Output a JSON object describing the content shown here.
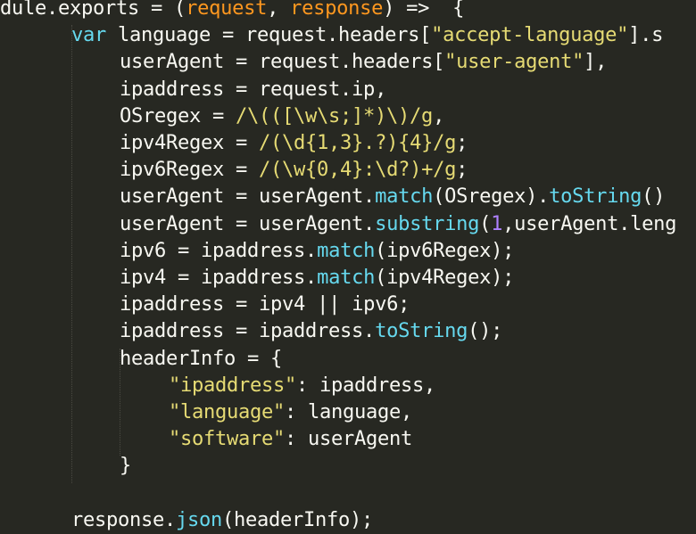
{
  "theme": {
    "background": "#272822",
    "text": "#f8f8f2",
    "keyword": "#66d9ef",
    "string": "#e6db74",
    "method": "#66d9ef",
    "param": "#fd971f",
    "number": "#ae81ff",
    "operator": "#f92672"
  },
  "lines": [
    {
      "indent": 0,
      "tokens": [
        [
          "text",
          "dule.exports "
        ],
        [
          "text",
          "= "
        ],
        [
          "text",
          "("
        ],
        [
          "param",
          "request"
        ],
        [
          "text",
          ", "
        ],
        [
          "param",
          "response"
        ],
        [
          "text",
          ") "
        ],
        [
          "text",
          "=>  "
        ],
        [
          "text",
          "{"
        ]
      ]
    },
    {
      "indent": 1,
      "tokens": [
        [
          "keyword",
          "var "
        ],
        [
          "text",
          "language "
        ],
        [
          "text",
          "= "
        ],
        [
          "text",
          "request.headers["
        ],
        [
          "string",
          "\"accept-language\""
        ],
        [
          "text",
          "].s"
        ]
      ]
    },
    {
      "indent": 2,
      "tokens": [
        [
          "text",
          "userAgent "
        ],
        [
          "text",
          "= "
        ],
        [
          "text",
          "request.headers["
        ],
        [
          "string",
          "\"user-agent\""
        ],
        [
          "text",
          "],"
        ]
      ]
    },
    {
      "indent": 2,
      "tokens": [
        [
          "text",
          "ipaddress "
        ],
        [
          "text",
          "= "
        ],
        [
          "text",
          "request.ip,"
        ]
      ]
    },
    {
      "indent": 2,
      "tokens": [
        [
          "text",
          "OSregex "
        ],
        [
          "text",
          "= "
        ],
        [
          "string",
          "/\\(([\\w\\s;]*)\\)/g"
        ],
        [
          "text",
          ","
        ]
      ]
    },
    {
      "indent": 2,
      "tokens": [
        [
          "text",
          "ipv4Regex "
        ],
        [
          "text",
          "= "
        ],
        [
          "string",
          "/(\\d{1,3}.?){4}/g"
        ],
        [
          "text",
          ";"
        ]
      ]
    },
    {
      "indent": 2,
      "tokens": [
        [
          "text",
          "ipv6Regex "
        ],
        [
          "text",
          "= "
        ],
        [
          "string",
          "/(\\w{0,4}:\\d?)+/g"
        ],
        [
          "text",
          ";"
        ]
      ]
    },
    {
      "indent": 2,
      "tokens": [
        [
          "text",
          "userAgent "
        ],
        [
          "text",
          "= "
        ],
        [
          "text",
          "userAgent."
        ],
        [
          "method",
          "match"
        ],
        [
          "text",
          "(OSregex)."
        ],
        [
          "method",
          "toString"
        ],
        [
          "text",
          "()"
        ]
      ]
    },
    {
      "indent": 2,
      "tokens": [
        [
          "text",
          "userAgent "
        ],
        [
          "text",
          "= "
        ],
        [
          "text",
          "userAgent."
        ],
        [
          "method",
          "substring"
        ],
        [
          "text",
          "("
        ],
        [
          "number",
          "1"
        ],
        [
          "text",
          ",userAgent.leng"
        ]
      ]
    },
    {
      "indent": 2,
      "tokens": [
        [
          "text",
          "ipv6 "
        ],
        [
          "text",
          "= "
        ],
        [
          "text",
          "ipaddress."
        ],
        [
          "method",
          "match"
        ],
        [
          "text",
          "(ipv6Regex);"
        ]
      ]
    },
    {
      "indent": 2,
      "tokens": [
        [
          "text",
          "ipv4 "
        ],
        [
          "text",
          "= "
        ],
        [
          "text",
          "ipaddress."
        ],
        [
          "method",
          "match"
        ],
        [
          "text",
          "(ipv4Regex);"
        ]
      ]
    },
    {
      "indent": 2,
      "tokens": [
        [
          "text",
          "ipaddress "
        ],
        [
          "text",
          "= "
        ],
        [
          "text",
          "ipv4 "
        ],
        [
          "text",
          "|| "
        ],
        [
          "text",
          "ipv6;"
        ]
      ]
    },
    {
      "indent": 2,
      "tokens": [
        [
          "text",
          "ipaddress "
        ],
        [
          "text",
          "= "
        ],
        [
          "text",
          "ipaddress."
        ],
        [
          "method",
          "toString"
        ],
        [
          "text",
          "();"
        ]
      ]
    },
    {
      "indent": 2,
      "tokens": [
        [
          "text",
          "headerInfo "
        ],
        [
          "text",
          "= "
        ],
        [
          "text",
          "{"
        ]
      ]
    },
    {
      "indent": 3,
      "tokens": [
        [
          "string",
          "\"ipaddress\""
        ],
        [
          "text",
          ": ipaddress,"
        ]
      ]
    },
    {
      "indent": 3,
      "tokens": [
        [
          "string",
          "\"language\""
        ],
        [
          "text",
          ": language,"
        ]
      ]
    },
    {
      "indent": 3,
      "tokens": [
        [
          "string",
          "\"software\""
        ],
        [
          "text",
          ": userAgent"
        ]
      ]
    },
    {
      "indent": 2,
      "tokens": [
        [
          "text",
          "}"
        ]
      ]
    },
    {
      "indent": 0,
      "tokens": []
    },
    {
      "indent": 1,
      "tokens": [
        [
          "text",
          "response."
        ],
        [
          "method",
          "json"
        ],
        [
          "text",
          "(headerInfo);"
        ]
      ]
    }
  ]
}
